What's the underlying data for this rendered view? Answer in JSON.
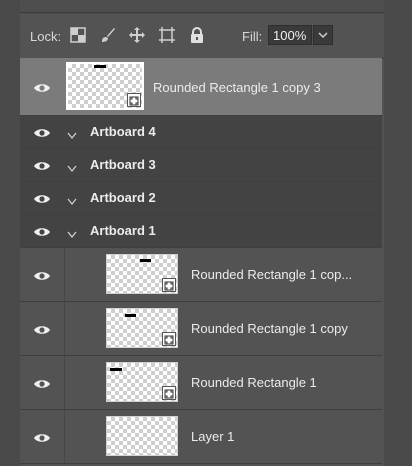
{
  "toolbar": {
    "lock_label": "Lock:",
    "fill_label": "Fill:",
    "fill_value": "100%",
    "lock_icons": [
      "lock-transparent-pixels-icon",
      "lock-image-pixels-icon",
      "lock-position-icon",
      "lock-artboard-icon",
      "lock-all-icon"
    ]
  },
  "layers": [
    {
      "type": "layer",
      "name": "Rounded Rectangle 1 copy 3",
      "selected": true,
      "visible": true,
      "smart_object": true
    },
    {
      "type": "artboard",
      "name": "Artboard 4",
      "expanded": false,
      "visible": true
    },
    {
      "type": "artboard",
      "name": "Artboard 3",
      "expanded": false,
      "visible": true
    },
    {
      "type": "artboard",
      "name": "Artboard 2",
      "expanded": false,
      "visible": true
    },
    {
      "type": "artboard",
      "name": "Artboard 1",
      "expanded": true,
      "visible": true
    },
    {
      "type": "layer",
      "name": "Rounded Rectangle 1 cop...",
      "selected": false,
      "visible": true,
      "smart_object": true
    },
    {
      "type": "layer",
      "name": "Rounded Rectangle 1 copy",
      "selected": false,
      "visible": true,
      "smart_object": true
    },
    {
      "type": "layer",
      "name": "Rounded Rectangle 1",
      "selected": false,
      "visible": true,
      "smart_object": true
    },
    {
      "type": "layer",
      "name": "Layer 1",
      "selected": false,
      "visible": true,
      "smart_object": false
    }
  ],
  "colors": {
    "panel_bg": "#535353",
    "artboard_row_bg": "#434343",
    "selected_row_bg": "#7b7b7b"
  }
}
